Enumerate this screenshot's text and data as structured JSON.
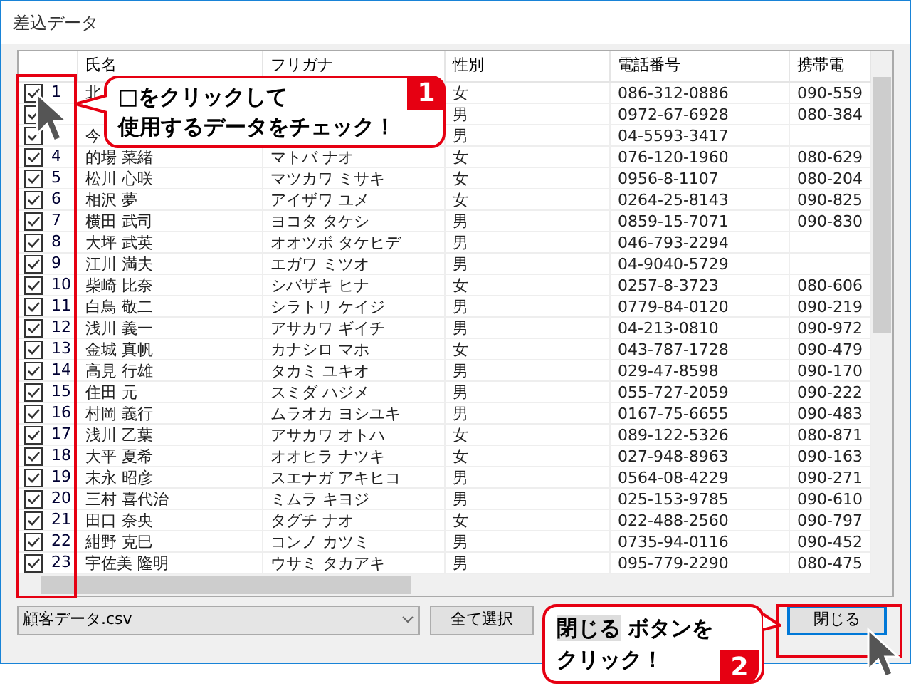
{
  "window": {
    "title": "差込データ"
  },
  "table": {
    "columns": [
      "氏名",
      "フリガナ",
      "性別",
      "電話番号",
      "携帯電"
    ],
    "rows": [
      {
        "checked": true,
        "no": "1",
        "name": "北",
        "gender": "女",
        "phone": "086-312-0886",
        "mobile": "090-559"
      },
      {
        "checked": true,
        "gender": "男",
        "phone": "0972-67-6928",
        "mobile": "080-384"
      },
      {
        "checked": true,
        "name": "今",
        "gender": "男",
        "phone": "04-5593-3417"
      },
      {
        "checked": true,
        "no": "4",
        "name": "的場 菜緒",
        "kana": "マトバ ナオ",
        "gender": "女",
        "phone": "076-120-1960",
        "mobile": "080-629"
      },
      {
        "checked": true,
        "no": "5",
        "name": "松川 心咲",
        "kana": "マツカワ ミサキ",
        "gender": "女",
        "phone": "0956-8-1107",
        "mobile": "080-204"
      },
      {
        "checked": true,
        "no": "6",
        "name": "相沢 夢",
        "kana": "アイザワ ユメ",
        "gender": "女",
        "phone": "0264-25-8143",
        "mobile": "090-825"
      },
      {
        "checked": true,
        "no": "7",
        "name": "横田 武司",
        "kana": "ヨコタ タケシ",
        "gender": "男",
        "phone": "0859-15-7071",
        "mobile": "090-830"
      },
      {
        "checked": true,
        "no": "8",
        "name": "大坪 武英",
        "kana": "オオツボ タケヒデ",
        "gender": "男",
        "phone": "046-793-2294"
      },
      {
        "checked": true,
        "no": "9",
        "name": "江川 満夫",
        "kana": "エガワ ミツオ",
        "gender": "男",
        "phone": "04-9040-5729"
      },
      {
        "checked": true,
        "no": "10",
        "name": "柴崎 比奈",
        "kana": "シバザキ ヒナ",
        "gender": "女",
        "phone": "0257-8-3723",
        "mobile": "080-606"
      },
      {
        "checked": true,
        "no": "11",
        "name": "白鳥 敬二",
        "kana": "シラトリ ケイジ",
        "gender": "男",
        "phone": "0779-84-0120",
        "mobile": "090-219"
      },
      {
        "checked": true,
        "no": "12",
        "name": "浅川 義一",
        "kana": "アサカワ ギイチ",
        "gender": "男",
        "phone": "04-213-0810",
        "mobile": "090-972"
      },
      {
        "checked": true,
        "no": "13",
        "name": "金城 真帆",
        "kana": "カナシロ マホ",
        "gender": "女",
        "phone": "043-787-1728",
        "mobile": "090-479"
      },
      {
        "checked": true,
        "no": "14",
        "name": "高見 行雄",
        "kana": "タカミ ユキオ",
        "gender": "男",
        "phone": "029-47-8598",
        "mobile": "090-170"
      },
      {
        "checked": true,
        "no": "15",
        "name": "住田 元",
        "kana": "スミダ ハジメ",
        "gender": "男",
        "phone": "055-727-2059",
        "mobile": "090-222"
      },
      {
        "checked": true,
        "no": "16",
        "name": "村岡 義行",
        "kana": "ムラオカ ヨシユキ",
        "gender": "男",
        "phone": "0167-75-6655",
        "mobile": "090-483"
      },
      {
        "checked": true,
        "no": "17",
        "name": "浅川 乙葉",
        "kana": "アサカワ オトハ",
        "gender": "女",
        "phone": "089-122-5326",
        "mobile": "080-871"
      },
      {
        "checked": true,
        "no": "18",
        "name": "大平 夏希",
        "kana": "オオヒラ ナツキ",
        "gender": "女",
        "phone": "027-948-8963",
        "mobile": "090-163"
      },
      {
        "checked": true,
        "no": "19",
        "name": "末永 昭彦",
        "kana": "スエナガ アキヒコ",
        "gender": "男",
        "phone": "0564-08-4229",
        "mobile": "090-271"
      },
      {
        "checked": true,
        "no": "20",
        "name": "三村 喜代治",
        "kana": "ミムラ キヨジ",
        "gender": "男",
        "phone": "025-153-9785",
        "mobile": "090-610"
      },
      {
        "checked": true,
        "no": "21",
        "name": "田口 奈央",
        "kana": "タグチ ナオ",
        "gender": "女",
        "phone": "022-488-2560",
        "mobile": "090-797"
      },
      {
        "checked": true,
        "no": "22",
        "name": "紺野 克巳",
        "kana": "コンノ カツミ",
        "gender": "男",
        "phone": "0735-94-0116",
        "mobile": "090-452"
      },
      {
        "checked": true,
        "no": "23",
        "name": "宇佐美 隆明",
        "kana": "ウサミ タカアキ",
        "gender": "男",
        "phone": "095-779-2290",
        "mobile": "080-475"
      }
    ]
  },
  "file_select": {
    "value": "顧客データ.csv"
  },
  "buttons": [
    "全て選択",
    "閉じる"
  ],
  "callouts": [
    {
      "number": "1",
      "lines": [
        "□をクリックして",
        "使用するデータをチェック！"
      ]
    },
    {
      "number": "2",
      "highlight": "閉じる",
      "lines": [
        " ボタンを",
        "クリック！"
      ]
    }
  ]
}
